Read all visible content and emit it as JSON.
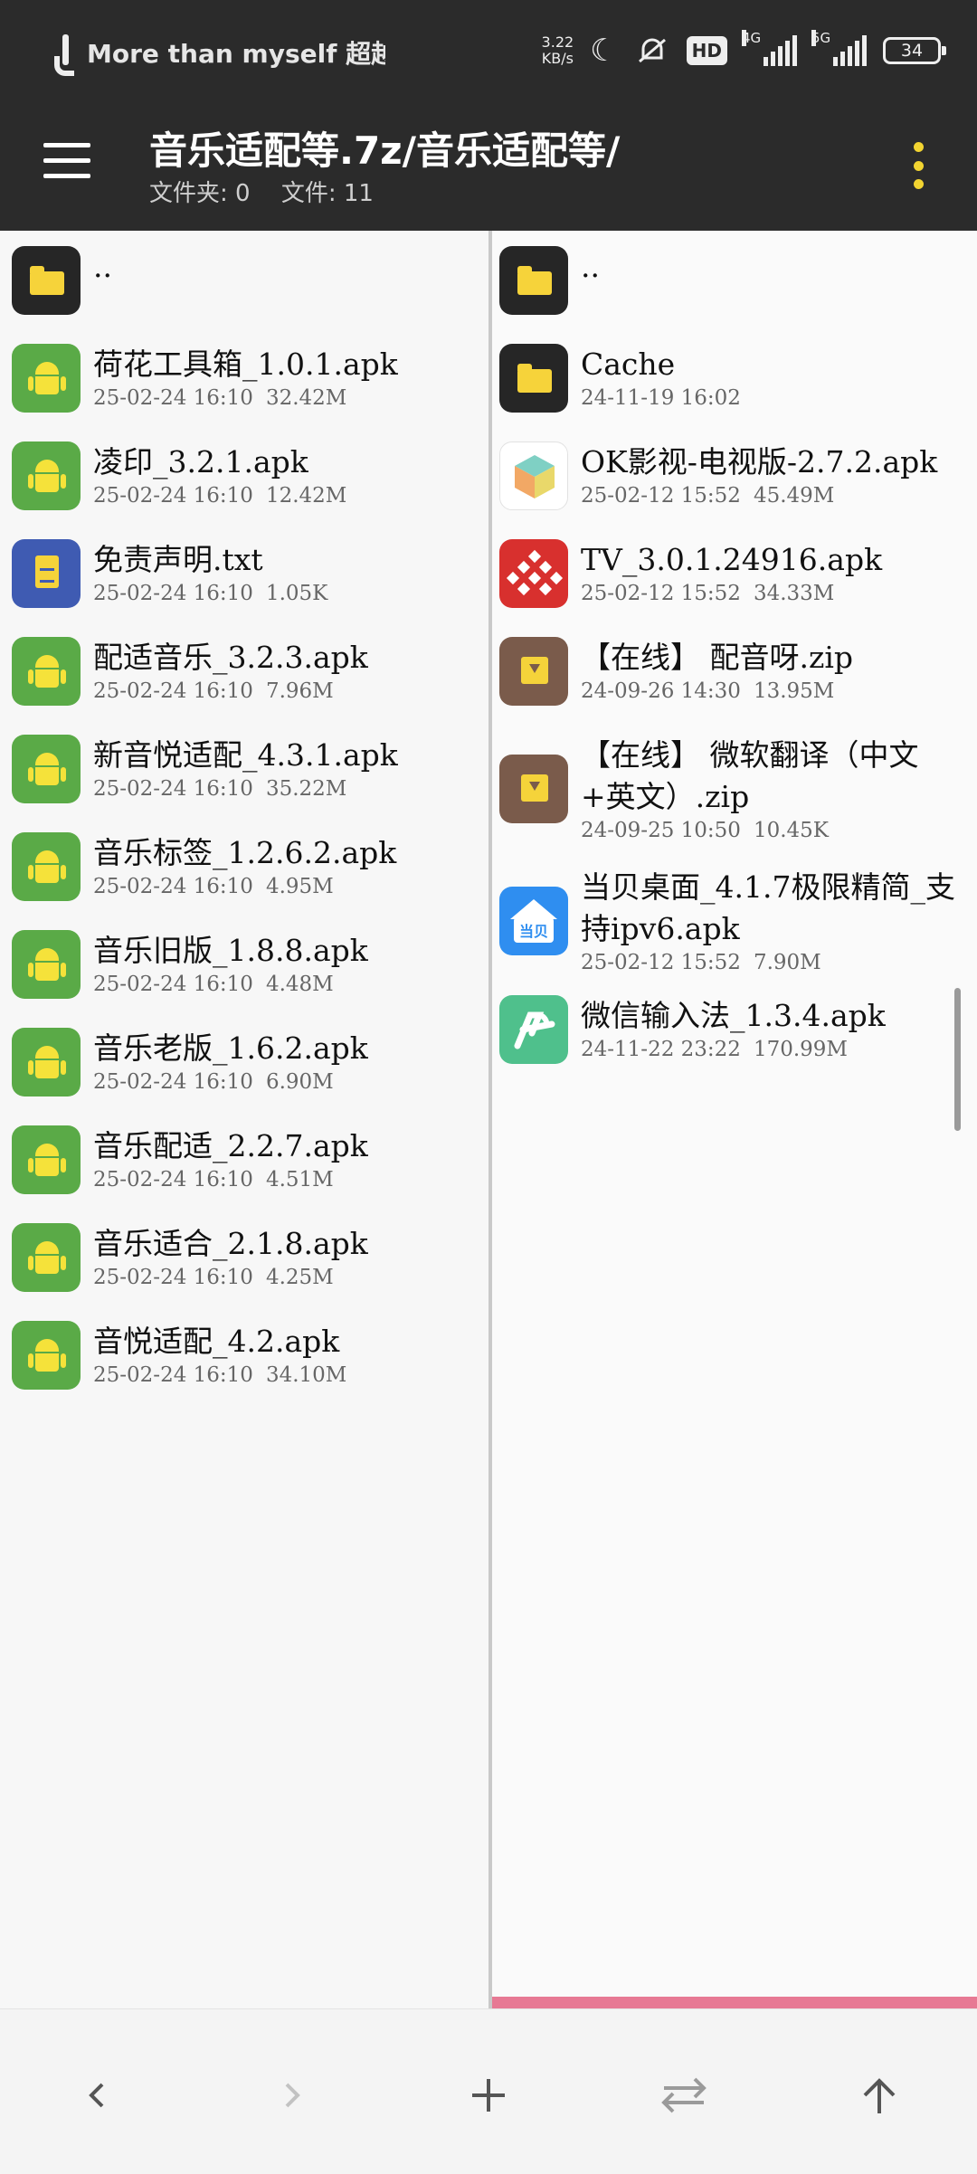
{
  "status_bar": {
    "notification_text": "More than myself 超越自",
    "net_speed_value": "3.22",
    "net_speed_unit": "KB/s",
    "hd_label": "HD",
    "signal1_label": "4G",
    "signal2_label": "5G",
    "battery": "34"
  },
  "app_bar": {
    "path": "音乐适配等.7z/音乐适配等/",
    "folders_label": "文件夹: 0",
    "files_label": "文件: 11"
  },
  "left_panel": {
    "items": [
      {
        "name": "..",
        "icon": "folder",
        "date": "",
        "size": ""
      },
      {
        "name": "荷花工具箱_1.0.1.apk",
        "icon": "android",
        "date": "25-02-24 16:10",
        "size": "32.42M"
      },
      {
        "name": "凌印_3.2.1.apk",
        "icon": "android",
        "date": "25-02-24 16:10",
        "size": "12.42M"
      },
      {
        "name": "免责声明.txt",
        "icon": "text",
        "date": "25-02-24 16:10",
        "size": "1.05K"
      },
      {
        "name": "配适音乐_3.2.3.apk",
        "icon": "android",
        "date": "25-02-24 16:10",
        "size": "7.96M"
      },
      {
        "name": "新音悦适配_4.3.1.apk",
        "icon": "android",
        "date": "25-02-24 16:10",
        "size": "35.22M"
      },
      {
        "name": "音乐标签_1.2.6.2.apk",
        "icon": "android",
        "date": "25-02-24 16:10",
        "size": "4.95M"
      },
      {
        "name": "音乐旧版_1.8.8.apk",
        "icon": "android",
        "date": "25-02-24 16:10",
        "size": "4.48M"
      },
      {
        "name": "音乐老版_1.6.2.apk",
        "icon": "android",
        "date": "25-02-24 16:10",
        "size": "6.90M"
      },
      {
        "name": "音乐配适_2.2.7.apk",
        "icon": "android",
        "date": "25-02-24 16:10",
        "size": "4.51M"
      },
      {
        "name": "音乐适合_2.1.8.apk",
        "icon": "android",
        "date": "25-02-24 16:10",
        "size": "4.25M"
      },
      {
        "name": "音悦适配_4.2.apk",
        "icon": "android",
        "date": "25-02-24 16:10",
        "size": "34.10M"
      }
    ]
  },
  "right_panel": {
    "items": [
      {
        "name": "..",
        "icon": "folder",
        "date": "",
        "size": ""
      },
      {
        "name": "Cache",
        "icon": "folder",
        "date": "24-11-19 16:02",
        "size": ""
      },
      {
        "name": "OK影视-电视版-2.7.2.apk",
        "icon": "cube",
        "date": "25-02-12 15:52",
        "size": "45.49M"
      },
      {
        "name": "TV_3.0.1.24916.apk",
        "icon": "tv",
        "date": "25-02-12 15:52",
        "size": "34.33M"
      },
      {
        "name": "【在线】 配音呀.zip",
        "icon": "archive",
        "date": "24-09-26 14:30",
        "size": "13.95M"
      },
      {
        "name": "【在线】 微软翻译（中文+英文）.zip",
        "icon": "archive",
        "date": "24-09-25 10:50",
        "size": "10.45K"
      },
      {
        "name": "当贝桌面_4.1.7极限精简_支持ipv6.apk",
        "icon": "dangbei",
        "date": "25-02-12 15:52",
        "size": "7.90M"
      },
      {
        "name": "微信输入法_1.3.4.apk",
        "icon": "wechat",
        "date": "24-11-22 23:22",
        "size": "170.99M"
      }
    ]
  },
  "icons": {
    "dangbei_label": "当贝"
  },
  "colors": {
    "app_bar": "#2b2b2b",
    "folder_yellow": "#f6d33a",
    "android_green": "#5aaa47",
    "active_panel_indicator": "#e77994"
  }
}
